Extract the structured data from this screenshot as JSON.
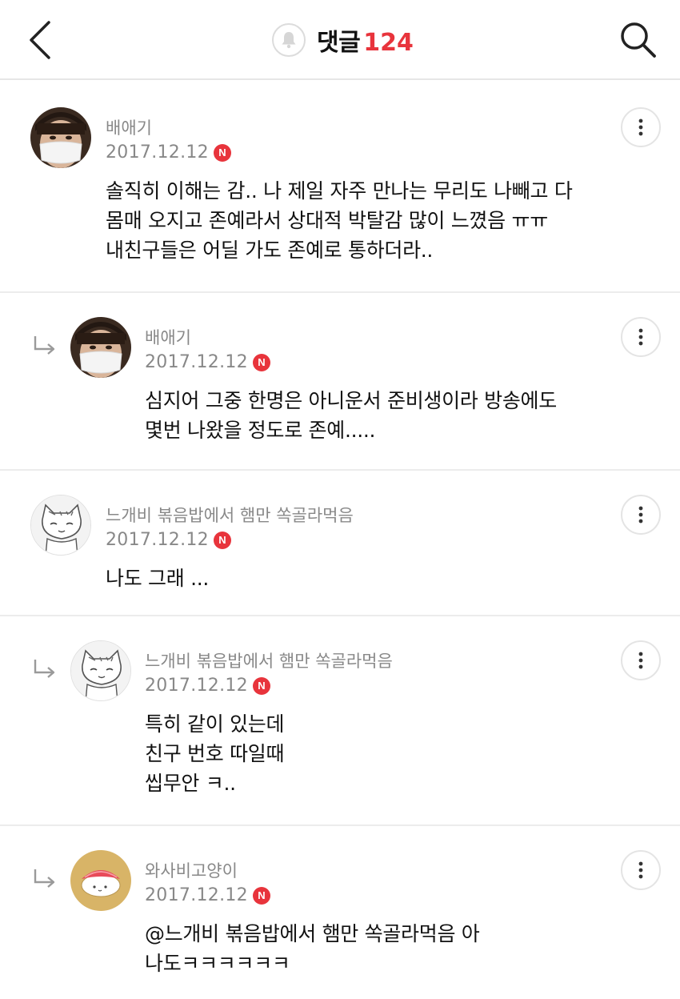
{
  "header": {
    "title": "댓글",
    "count": "124",
    "back_icon": "chevron-left-icon",
    "bell_icon": "bell-icon",
    "search_icon": "search-icon"
  },
  "comments": [
    {
      "nickname": "배애기",
      "date": "2017.12.12",
      "badge": "N",
      "lines": [
        "솔직히 이해는 감.. 나 제일 자주 만나는 무리도 나빼고 다",
        "몸매 오지고 존예라서 상대적 박탈감 많이 느꼈음 ㅠㅠ",
        "내친구들은 어딜 가도 존예로 통하더라.."
      ]
    },
    {
      "nickname": "배애기",
      "date": "2017.12.12",
      "badge": "N",
      "lines": [
        "심지어 그중 한명은 아니운서 준비생이라 방송에도",
        "몇번 나왔을 정도로 존예....."
      ]
    },
    {
      "nickname": "느개비 볶음밥에서 햄만 쏙골라먹음",
      "date": "2017.12.12",
      "badge": "N",
      "lines": [
        "나도 그래 ..."
      ]
    },
    {
      "nickname": "느개비 볶음밥에서 햄만 쏙골라먹음",
      "date": "2017.12.12",
      "badge": "N",
      "lines": [
        "특히 같이 있는데",
        "친구 번호 따일때",
        "씹무안 ㅋ.."
      ]
    },
    {
      "nickname": "와사비고양이",
      "date": "2017.12.12",
      "badge": "N",
      "lines": [
        "@느개비 볶음밥에서 햄만 쏙골라먹음 아",
        "나도ㅋㅋㅋㅋㅋㅋ"
      ]
    }
  ],
  "colors": {
    "accent": "#e8343c",
    "meta": "#888888",
    "divider": "#ececec"
  }
}
